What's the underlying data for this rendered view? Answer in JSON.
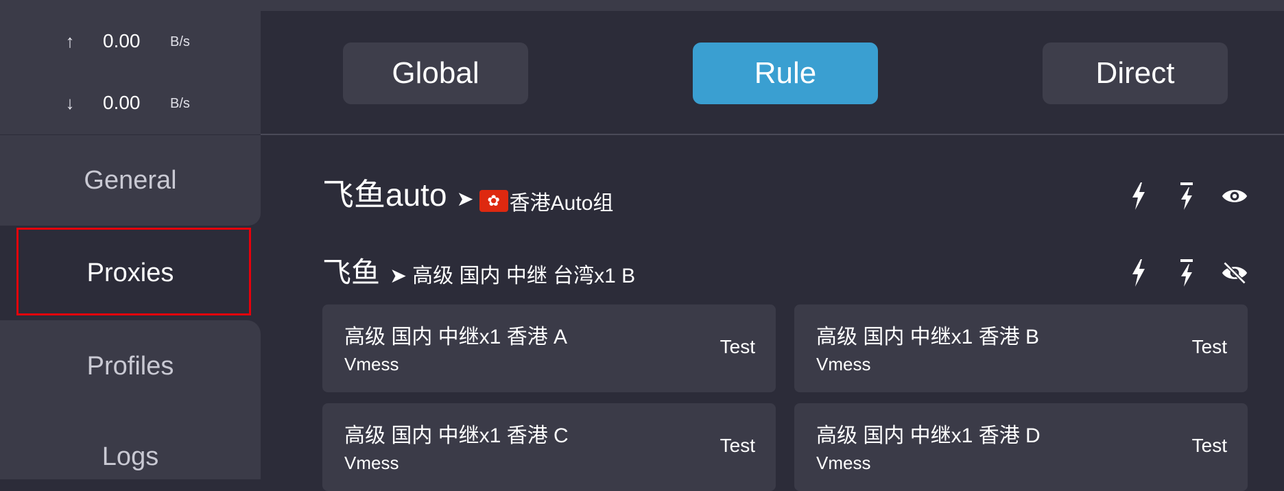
{
  "speed": {
    "upload_arrow": "↑",
    "upload_value": "0.00",
    "upload_unit": "B/s",
    "download_arrow": "↓",
    "download_value": "0.00",
    "download_unit": "B/s"
  },
  "nav": {
    "items": [
      {
        "label": "General"
      },
      {
        "label": "Proxies"
      },
      {
        "label": "Profiles"
      },
      {
        "label": "Logs"
      }
    ]
  },
  "modes": {
    "global": "Global",
    "rule": "Rule",
    "direct": "Direct",
    "active": "Rule"
  },
  "groups": [
    {
      "name": "飞鱼auto",
      "arrow": "➤",
      "selected": "香港Auto组",
      "flag": "🇭🇰"
    },
    {
      "name": "飞鱼",
      "arrow": "➤",
      "selected": "高级 国内 中继 台湾x1 B"
    }
  ],
  "proxies": [
    {
      "name": "高级 国内 中继x1 香港 A",
      "type": "Vmess",
      "test": "Test"
    },
    {
      "name": "高级 国内 中继x1 香港 B",
      "type": "Vmess",
      "test": "Test"
    },
    {
      "name": "高级 国内 中继x1 香港 C",
      "type": "Vmess",
      "test": "Test"
    },
    {
      "name": "高级 国内 中继x1 香港 D",
      "type": "Vmess",
      "test": "Test"
    }
  ],
  "colors": {
    "accent": "#3a9fd1",
    "highlight_frame": "#e8000b",
    "background": "#2c2c39",
    "panel": "#3b3b48"
  }
}
